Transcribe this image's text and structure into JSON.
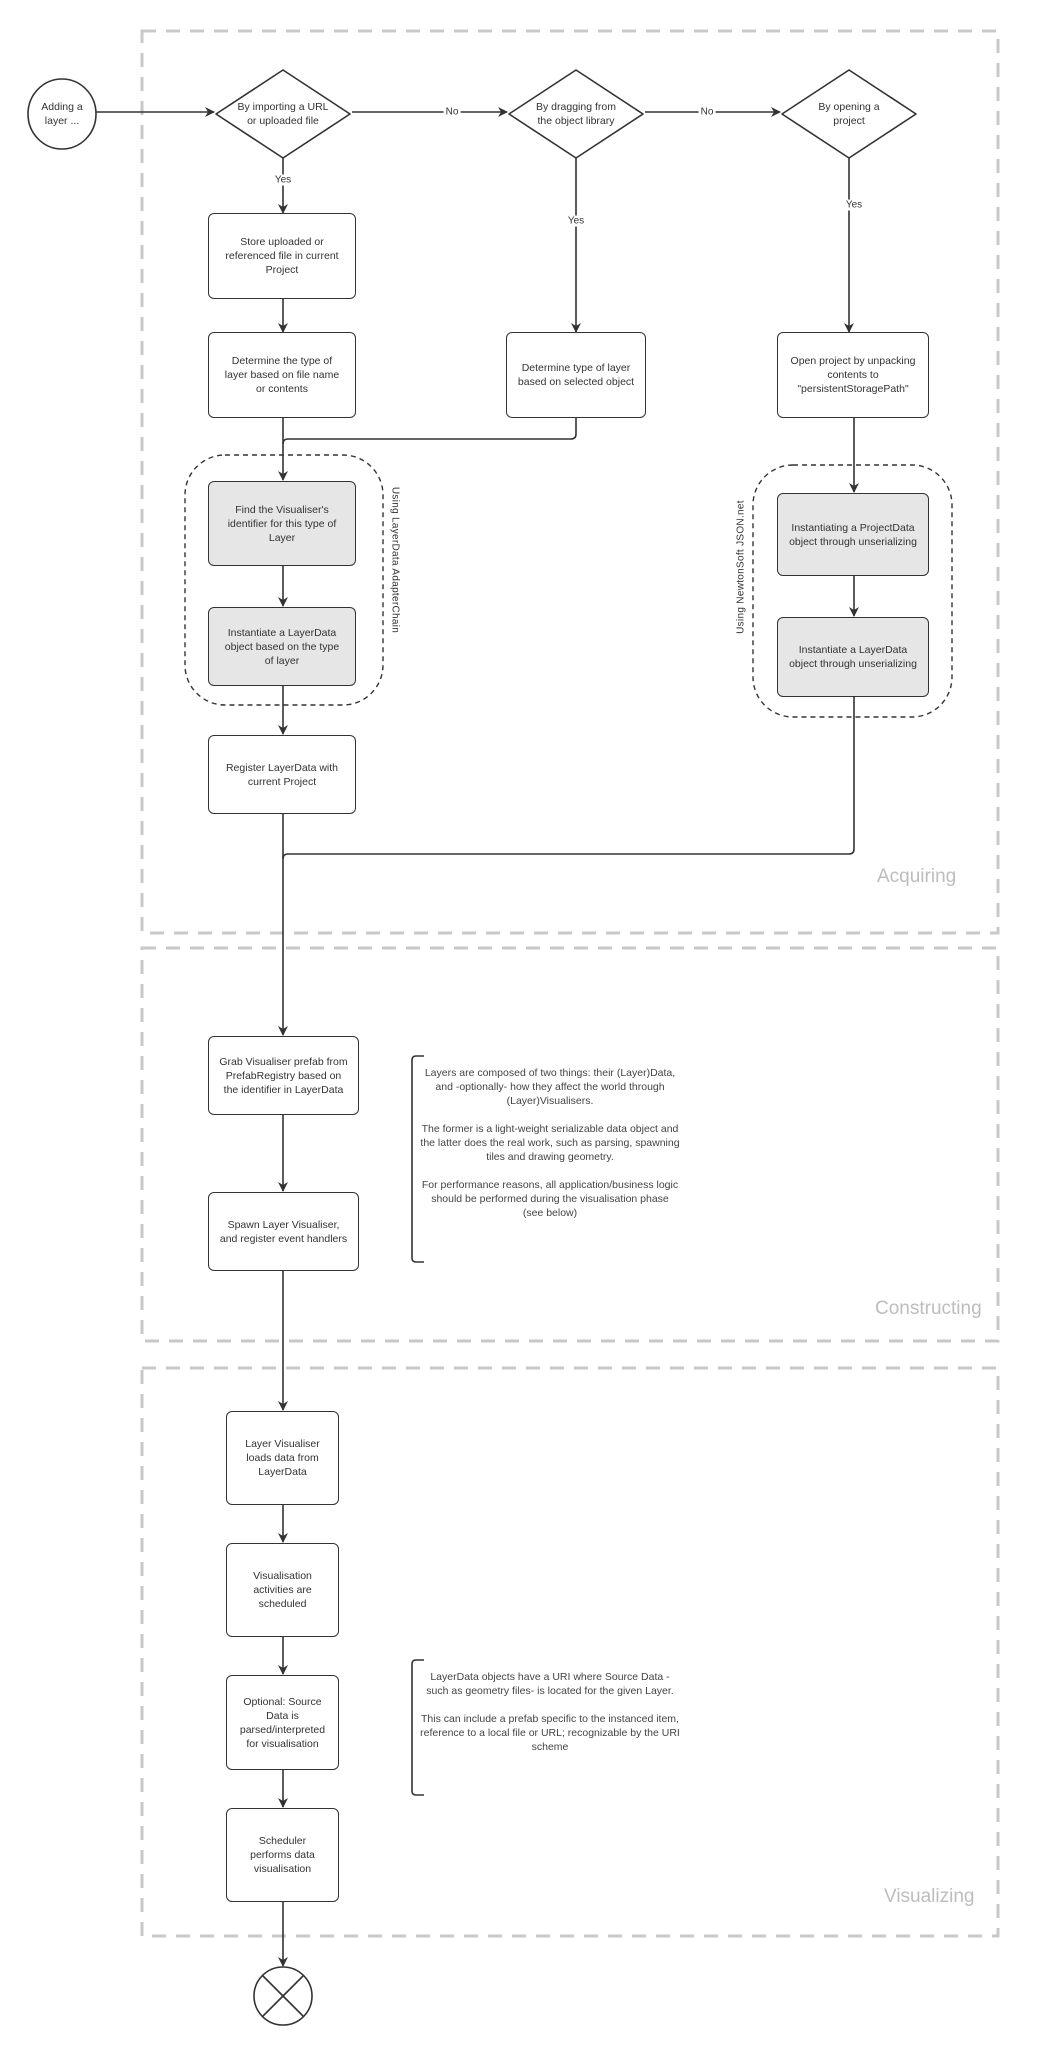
{
  "start": {
    "label": "Adding a layer ..."
  },
  "decisions": [
    {
      "label": "By importing a URL or uploaded file"
    },
    {
      "label": "By dragging from the object library"
    },
    {
      "label": "By opening a project"
    }
  ],
  "edge_labels": {
    "no1": "No",
    "no2": "No",
    "yes1": "Yes",
    "yes2": "Yes",
    "yes3": "Yes"
  },
  "acquiring": {
    "title": "Acquiring",
    "store": "Store uploaded or referenced file in current Project",
    "determine_file": "Determine the type of layer based on file name or contents",
    "determine_object": "Determine type of layer based on selected object",
    "open_project": "Open project by unpacking contents to \"persistentStoragePath\"",
    "adapter_group_label": "Using LayerData AdapterChain",
    "find_identifier": "Find the Visualiser's identifier for this type of Layer",
    "instantiate_type": "Instantiate a LayerData object based on the type of layer",
    "json_group_label": "Using NewtonSoft JSON.net",
    "instantiate_project": "Instantiating a ProjectData object through unserializing",
    "instantiate_unserialize": "Instantiate a LayerData object through unserializing",
    "register": "Register LayerData with current Project"
  },
  "constructing": {
    "title": "Constructing",
    "grab": "Grab Visualiser prefab from PrefabRegistry based on the identifier in LayerData",
    "spawn": "Spawn Layer Visualiser, and register event handlers",
    "note": "Layers are composed of two things: their (Layer)Data, and -optionally- how they affect the world through (Layer)Visualisers.\n\nThe former is a light-weight serializable data object and the latter does the real work, such as parsing, spawning tiles and drawing geometry.\n\nFor performance reasons, all application/business logic should be performed during the visualisation phase (see below)"
  },
  "visualizing": {
    "title": "Visualizing",
    "loads": "Layer Visualiser loads data from LayerData",
    "scheduled": "Visualisation activities are scheduled",
    "parsed": "Optional: Source Data is parsed/interpreted for visualisation",
    "performs": "Scheduler performs data visualisation",
    "note": "LayerData objects have a URI where Source Data -such as geometry files- is located for the given Layer.\n\nThis can include a prefab specific to the instanced item, reference to a local file or URL; recognizable by the URI scheme"
  },
  "end": {
    "icon": "end-cross-icon"
  },
  "colors": {
    "stroke": "#333333",
    "process_grey": "#e6e6e6",
    "section_border": "#c8c8c8",
    "section_label": "#bdbdbd"
  }
}
